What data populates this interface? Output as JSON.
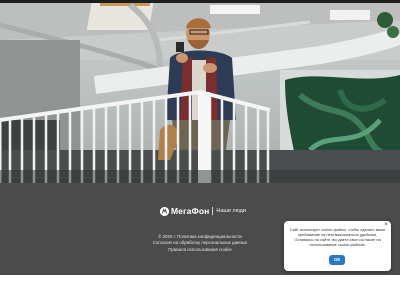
{
  "brand": {
    "name": "МегаФон",
    "slogan": "Наши люди"
  },
  "footer": {
    "copyright_policy": "© 2020 г. Политика конфиденциальности",
    "consent_link": "Согласие на обработку персональных данных",
    "cookie_rules_link": "Правила использования cookie"
  },
  "cookie_popup": {
    "close_label": "×",
    "message": "Сайт использует cookie-файлы, чтобы сделать ваше пребывание на нем максимально удобным. Оставаясь на сайте, вы даете свое согласие на использование cookie-файлов.",
    "ok_label": "ОК"
  },
  "colors": {
    "footer_bg": "#4b4b4b",
    "ok_button": "#2a79c8",
    "brand_green": "#00b956"
  },
  "icons": {
    "brand_logo": "megafon-logo-icon",
    "close": "close-icon"
  }
}
